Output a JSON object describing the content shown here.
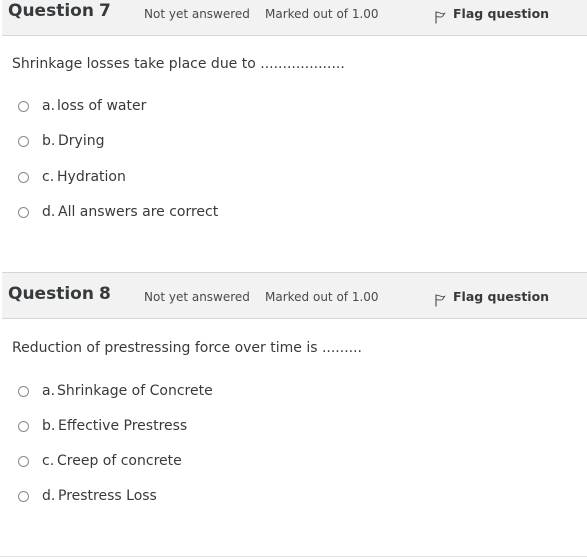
{
  "questions": [
    {
      "title_word": "Question",
      "number": "7",
      "state": "Not yet answered",
      "grade": "Marked out of 1.00",
      "flag_label": "Flag question",
      "text": "Shrinkage losses take place due to ...................",
      "options": [
        {
          "letter": "a.",
          "text": "loss of water"
        },
        {
          "letter": "b.",
          "text": "Drying"
        },
        {
          "letter": "c.",
          "text": "Hydration"
        },
        {
          "letter": "d.",
          "text": "All answers are correct"
        }
      ]
    },
    {
      "title_word": "Question",
      "number": "8",
      "state": "Not yet answered",
      "grade": "Marked out of 1.00",
      "flag_label": "Flag question",
      "text": "Reduction of prestressing force over time is .........",
      "options": [
        {
          "letter": "a.",
          "text": "Shrinkage of Concrete"
        },
        {
          "letter": "b.",
          "text": "Effective Prestress"
        },
        {
          "letter": "c.",
          "text": "Creep of concrete"
        },
        {
          "letter": "d.",
          "text": "Prestress Loss"
        }
      ]
    }
  ],
  "colors": {
    "header_bg": "#f2f2f2",
    "text": "#373a3c",
    "radio_border": "#8a8a8a"
  },
  "icons": {
    "flag": "flag-icon",
    "radio": "radio-circle"
  }
}
